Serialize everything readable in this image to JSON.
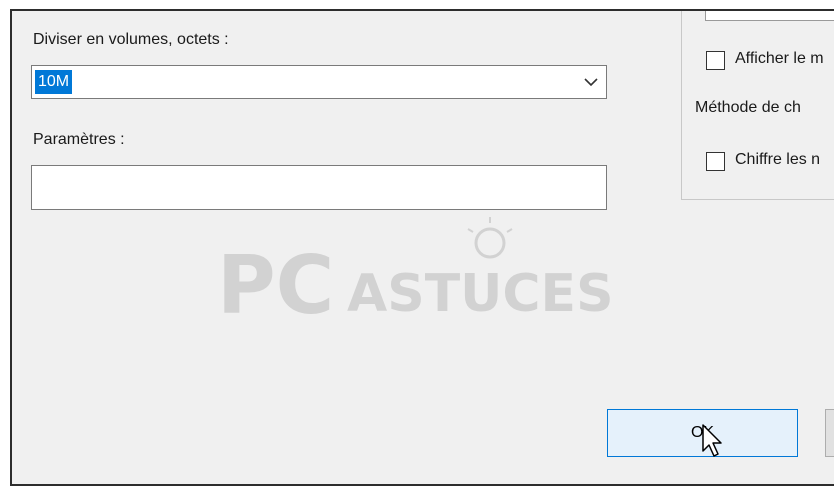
{
  "split": {
    "label": "Diviser en volumes, octets :",
    "value": "10M"
  },
  "params": {
    "label": "Paramètres :",
    "value": ""
  },
  "encryption": {
    "show_password_label": "Afficher le m",
    "method_label": "Méthode de ch",
    "encrypt_names_label": "Chiffre les n"
  },
  "watermark": {
    "brand_left": "PC",
    "brand_right": "ASTUCES"
  },
  "buttons": {
    "ok_label": "OK"
  },
  "colors": {
    "dialog_bg": "#f0f0f0",
    "selection": "#0078d7",
    "ok_button_bg": "#e5f1fb"
  },
  "icons": {
    "dropdown": "chevron-down-icon",
    "cursor": "mouse-pointer-icon"
  }
}
